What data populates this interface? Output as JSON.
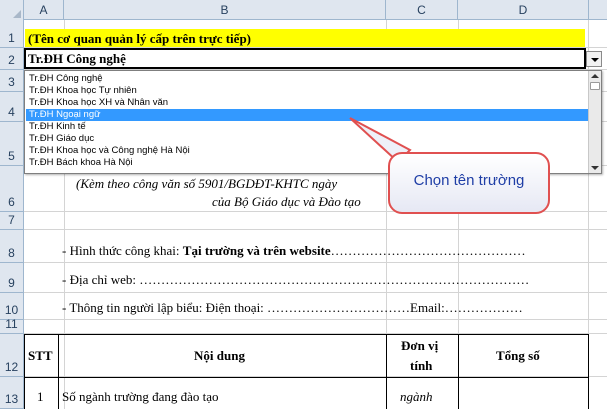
{
  "columns": [
    "A",
    "B",
    "C",
    "D"
  ],
  "rows": [
    "1",
    "2",
    "3",
    "4",
    "5",
    "6",
    "7",
    "8",
    "9",
    "10",
    "11",
    "12",
    "13"
  ],
  "cells": {
    "r1": "(Tên cơ quan quản lý cấp trên trực tiếp)",
    "r2": "Tr.ĐH  Công nghệ",
    "r5_line1": "(Kèm theo công văn số 5901/BGDĐT-KHTC  ngày",
    "r6": "của Bộ Giáo dục và Đào tạo",
    "r8_prefix": "- Hình thức công khai: ",
    "r8_bold": "Tại trường và trên website",
    "r8_dots": "………………………………………",
    "r9": "- Địa chỉ web: ………………………………………………………………………………",
    "r10": "- Thông tin người lập biểu:  Điện thoại: ……………………………Email:………………",
    "r12_stt": "STT",
    "r12_noidung": "Nội dung",
    "r12_donvi_1": "Đơn vị",
    "r12_donvi_2": "tính",
    "r12_tongso": "Tổng số",
    "r13_stt": "1",
    "r13_noidung": "Số ngành trường đang đào tạo",
    "r13_donvi": "ngành"
  },
  "dropdown": {
    "items": [
      "Tr.ĐH  Công nghệ",
      "Tr.ĐH Khoa học Tự nhiên",
      "Tr.ĐH Khoa học XH và Nhân văn",
      "Tr.ĐH  Ngoại ngữ",
      "Tr.ĐH Kinh tế",
      "Tr.ĐH Giáo dục",
      "Tr.ĐH Khoa học và Công nghệ Hà Nội",
      "Tr.ĐH Bách khoa Hà Nội"
    ],
    "selected_index": 3
  },
  "callout": {
    "text": "Chọn tên trường",
    "border_color": "#e05050",
    "text_color": "#1f3ea6"
  },
  "colors": {
    "header_bg": "#dfe6ef",
    "highlight_yellow": "#ffff00",
    "selection_blue": "#3399ff"
  }
}
